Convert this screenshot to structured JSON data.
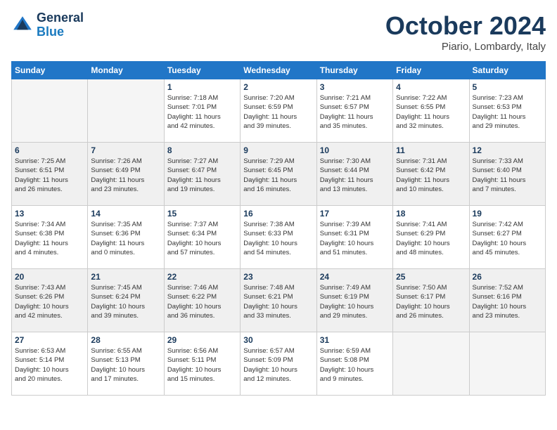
{
  "header": {
    "logo_general": "General",
    "logo_blue": "Blue",
    "month": "October 2024",
    "location": "Piario, Lombardy, Italy"
  },
  "weekdays": [
    "Sunday",
    "Monday",
    "Tuesday",
    "Wednesday",
    "Thursday",
    "Friday",
    "Saturday"
  ],
  "weeks": [
    [
      {
        "day": "",
        "info": "",
        "empty": true
      },
      {
        "day": "",
        "info": "",
        "empty": true
      },
      {
        "day": "1",
        "info": "Sunrise: 7:18 AM\nSunset: 7:01 PM\nDaylight: 11 hours\nand 42 minutes."
      },
      {
        "day": "2",
        "info": "Sunrise: 7:20 AM\nSunset: 6:59 PM\nDaylight: 11 hours\nand 39 minutes."
      },
      {
        "day": "3",
        "info": "Sunrise: 7:21 AM\nSunset: 6:57 PM\nDaylight: 11 hours\nand 35 minutes."
      },
      {
        "day": "4",
        "info": "Sunrise: 7:22 AM\nSunset: 6:55 PM\nDaylight: 11 hours\nand 32 minutes."
      },
      {
        "day": "5",
        "info": "Sunrise: 7:23 AM\nSunset: 6:53 PM\nDaylight: 11 hours\nand 29 minutes."
      }
    ],
    [
      {
        "day": "6",
        "info": "Sunrise: 7:25 AM\nSunset: 6:51 PM\nDaylight: 11 hours\nand 26 minutes.",
        "shaded": true
      },
      {
        "day": "7",
        "info": "Sunrise: 7:26 AM\nSunset: 6:49 PM\nDaylight: 11 hours\nand 23 minutes.",
        "shaded": true
      },
      {
        "day": "8",
        "info": "Sunrise: 7:27 AM\nSunset: 6:47 PM\nDaylight: 11 hours\nand 19 minutes.",
        "shaded": true
      },
      {
        "day": "9",
        "info": "Sunrise: 7:29 AM\nSunset: 6:45 PM\nDaylight: 11 hours\nand 16 minutes.",
        "shaded": true
      },
      {
        "day": "10",
        "info": "Sunrise: 7:30 AM\nSunset: 6:44 PM\nDaylight: 11 hours\nand 13 minutes.",
        "shaded": true
      },
      {
        "day": "11",
        "info": "Sunrise: 7:31 AM\nSunset: 6:42 PM\nDaylight: 11 hours\nand 10 minutes.",
        "shaded": true
      },
      {
        "day": "12",
        "info": "Sunrise: 7:33 AM\nSunset: 6:40 PM\nDaylight: 11 hours\nand 7 minutes.",
        "shaded": true
      }
    ],
    [
      {
        "day": "13",
        "info": "Sunrise: 7:34 AM\nSunset: 6:38 PM\nDaylight: 11 hours\nand 4 minutes."
      },
      {
        "day": "14",
        "info": "Sunrise: 7:35 AM\nSunset: 6:36 PM\nDaylight: 11 hours\nand 0 minutes."
      },
      {
        "day": "15",
        "info": "Sunrise: 7:37 AM\nSunset: 6:34 PM\nDaylight: 10 hours\nand 57 minutes."
      },
      {
        "day": "16",
        "info": "Sunrise: 7:38 AM\nSunset: 6:33 PM\nDaylight: 10 hours\nand 54 minutes."
      },
      {
        "day": "17",
        "info": "Sunrise: 7:39 AM\nSunset: 6:31 PM\nDaylight: 10 hours\nand 51 minutes."
      },
      {
        "day": "18",
        "info": "Sunrise: 7:41 AM\nSunset: 6:29 PM\nDaylight: 10 hours\nand 48 minutes."
      },
      {
        "day": "19",
        "info": "Sunrise: 7:42 AM\nSunset: 6:27 PM\nDaylight: 10 hours\nand 45 minutes."
      }
    ],
    [
      {
        "day": "20",
        "info": "Sunrise: 7:43 AM\nSunset: 6:26 PM\nDaylight: 10 hours\nand 42 minutes.",
        "shaded": true
      },
      {
        "day": "21",
        "info": "Sunrise: 7:45 AM\nSunset: 6:24 PM\nDaylight: 10 hours\nand 39 minutes.",
        "shaded": true
      },
      {
        "day": "22",
        "info": "Sunrise: 7:46 AM\nSunset: 6:22 PM\nDaylight: 10 hours\nand 36 minutes.",
        "shaded": true
      },
      {
        "day": "23",
        "info": "Sunrise: 7:48 AM\nSunset: 6:21 PM\nDaylight: 10 hours\nand 33 minutes.",
        "shaded": true
      },
      {
        "day": "24",
        "info": "Sunrise: 7:49 AM\nSunset: 6:19 PM\nDaylight: 10 hours\nand 29 minutes.",
        "shaded": true
      },
      {
        "day": "25",
        "info": "Sunrise: 7:50 AM\nSunset: 6:17 PM\nDaylight: 10 hours\nand 26 minutes.",
        "shaded": true
      },
      {
        "day": "26",
        "info": "Sunrise: 7:52 AM\nSunset: 6:16 PM\nDaylight: 10 hours\nand 23 minutes.",
        "shaded": true
      }
    ],
    [
      {
        "day": "27",
        "info": "Sunrise: 6:53 AM\nSunset: 5:14 PM\nDaylight: 10 hours\nand 20 minutes."
      },
      {
        "day": "28",
        "info": "Sunrise: 6:55 AM\nSunset: 5:13 PM\nDaylight: 10 hours\nand 17 minutes."
      },
      {
        "day": "29",
        "info": "Sunrise: 6:56 AM\nSunset: 5:11 PM\nDaylight: 10 hours\nand 15 minutes."
      },
      {
        "day": "30",
        "info": "Sunrise: 6:57 AM\nSunset: 5:09 PM\nDaylight: 10 hours\nand 12 minutes."
      },
      {
        "day": "31",
        "info": "Sunrise: 6:59 AM\nSunset: 5:08 PM\nDaylight: 10 hours\nand 9 minutes."
      },
      {
        "day": "",
        "info": "",
        "empty": true
      },
      {
        "day": "",
        "info": "",
        "empty": true
      }
    ]
  ]
}
